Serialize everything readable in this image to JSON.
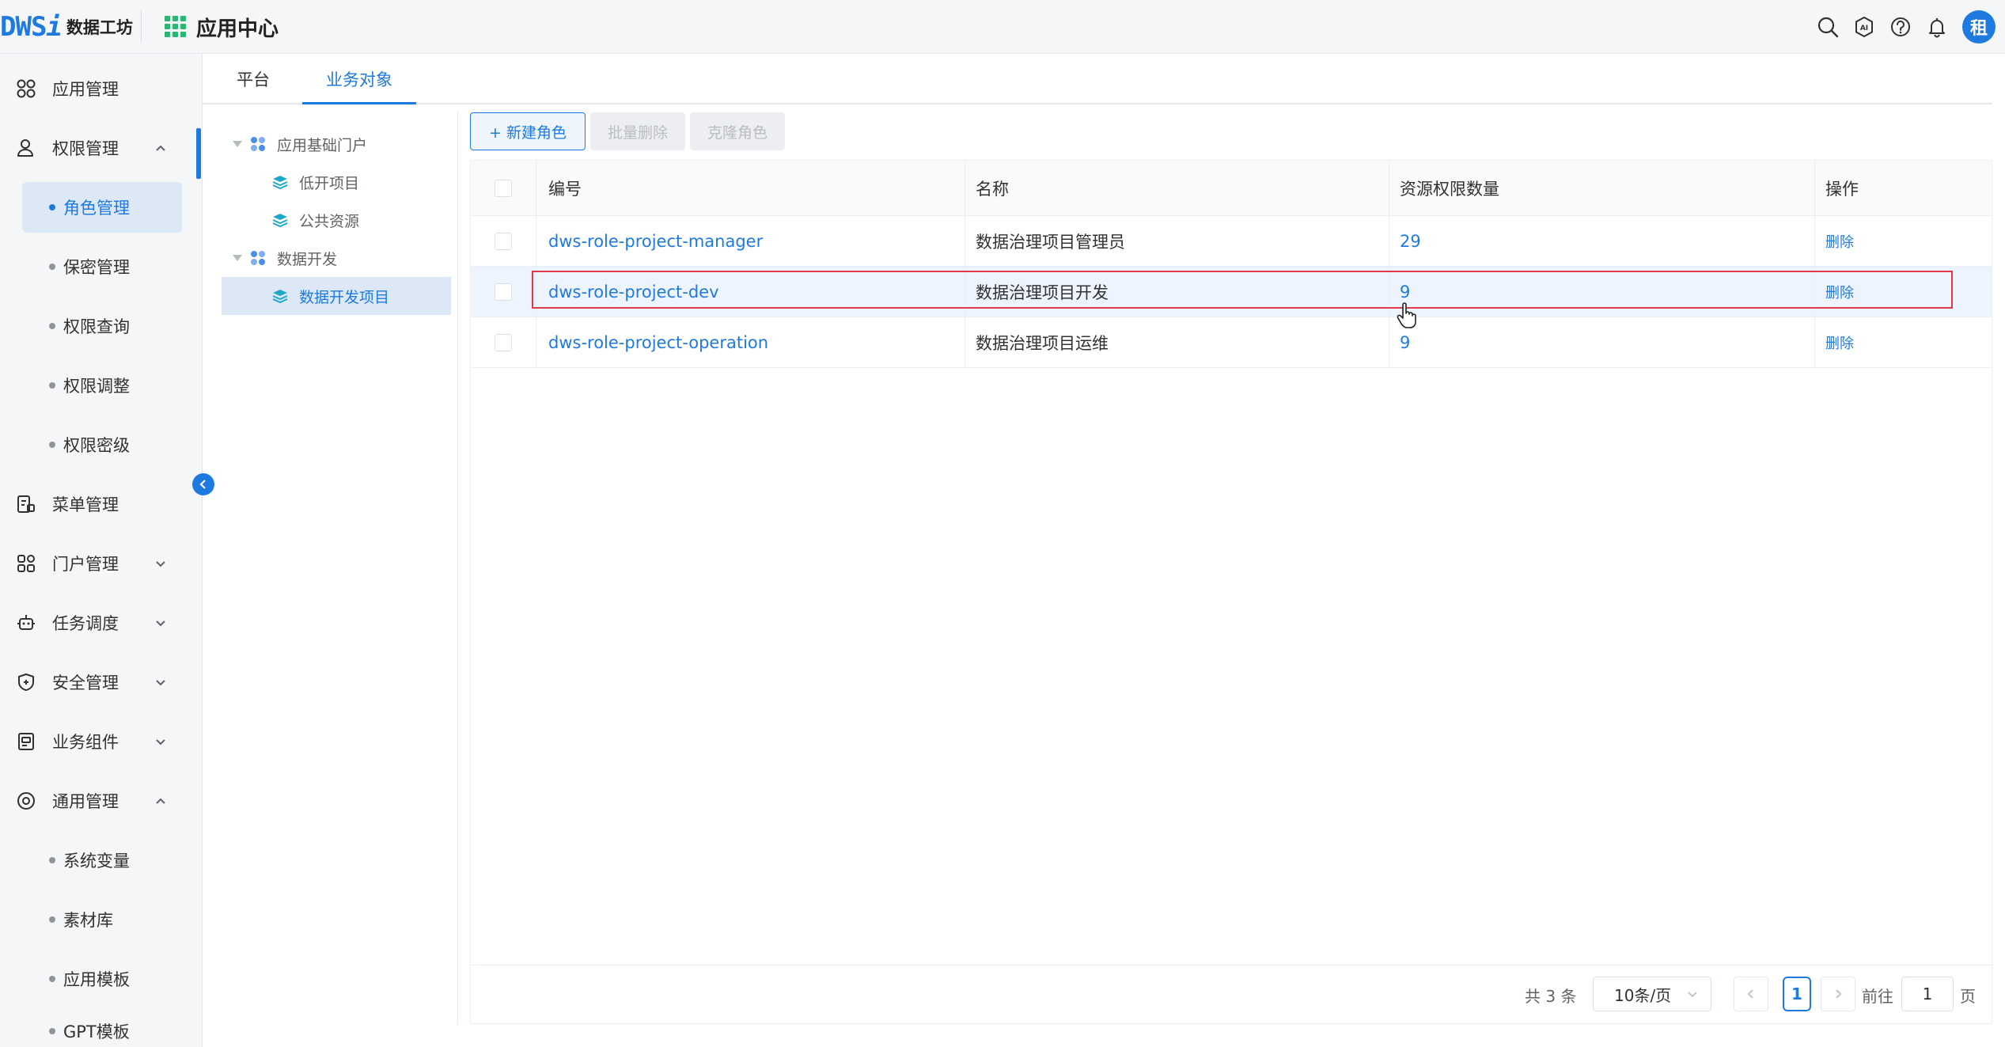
{
  "header": {
    "logo_mark": "DWS",
    "logo_mark_i": "i",
    "logo_text": "数据工坊",
    "app_center": "应用中心",
    "avatar_text": "租",
    "icons": [
      "search-icon",
      "ai-icon",
      "help-icon",
      "bell-icon"
    ]
  },
  "sidebar": {
    "items": [
      {
        "label": "应用管理",
        "icon": "app-grid-icon"
      },
      {
        "label": "权限管理",
        "icon": "user-lock-icon",
        "expanded": true
      },
      {
        "label": "菜单管理",
        "icon": "menu-doc-icon"
      },
      {
        "label": "门户管理",
        "icon": "portal-icon",
        "expanded": false
      },
      {
        "label": "任务调度",
        "icon": "robot-icon",
        "expanded": false
      },
      {
        "label": "安全管理",
        "icon": "shield-icon",
        "expanded": false
      },
      {
        "label": "业务组件",
        "icon": "component-icon",
        "expanded": false
      },
      {
        "label": "通用管理",
        "icon": "settings-circle-icon",
        "expanded": true
      }
    ],
    "permission_sub": [
      "角色管理",
      "保密管理",
      "权限查询",
      "权限调整",
      "权限密级"
    ],
    "general_sub": [
      "系统变量",
      "素材库",
      "应用模板",
      "GPT模板"
    ],
    "active_sub": "角色管理"
  },
  "tabs": [
    "平台",
    "业务对象"
  ],
  "active_tab": "业务对象",
  "tree": {
    "nodes": [
      {
        "label": "应用基础门户",
        "level": 0
      },
      {
        "label": "低开项目",
        "level": 1
      },
      {
        "label": "公共资源",
        "level": 1
      },
      {
        "label": "数据开发",
        "level": 0
      },
      {
        "label": "数据开发项目",
        "level": 1,
        "selected": true
      }
    ]
  },
  "toolbar": {
    "new_role": "+ 新建角色",
    "batch_delete": "批量删除",
    "clone_role": "克隆角色"
  },
  "table": {
    "columns": [
      "编号",
      "名称",
      "资源权限数量",
      "操作"
    ],
    "rows": [
      {
        "code": "dws-role-project-manager",
        "name": "数据治理项目管理员",
        "count": "29",
        "action": "删除"
      },
      {
        "code": "dws-role-project-dev",
        "name": "数据治理项目开发",
        "count": "9",
        "action": "删除"
      },
      {
        "code": "dws-role-project-operation",
        "name": "数据治理项目运维",
        "count": "9",
        "action": "删除"
      }
    ]
  },
  "pagination": {
    "total": "共 3 条",
    "page_size": "10条/页",
    "current": "1",
    "goto_prefix": "前往",
    "goto_value": "1",
    "goto_suffix": "页"
  },
  "colors": {
    "accent": "#1f7ae0",
    "highlight": "#e33a4a",
    "logo_grid": "#2bb673"
  }
}
